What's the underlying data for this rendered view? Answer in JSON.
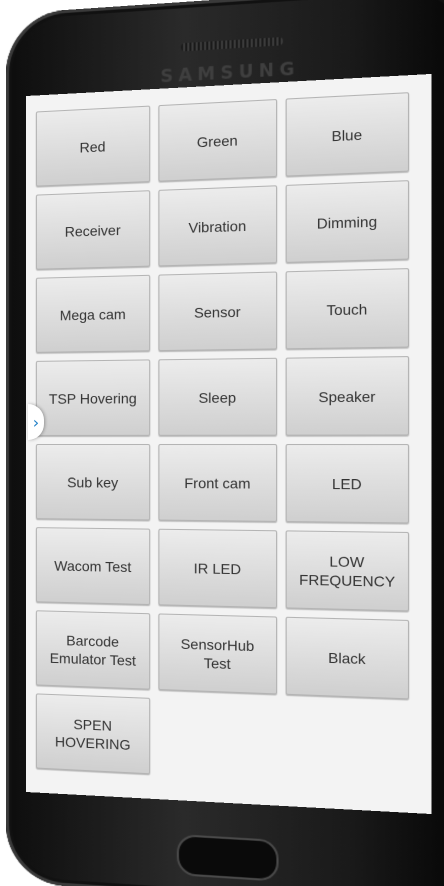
{
  "device": {
    "brand": "SAMSUNG"
  },
  "screen": {
    "buttons": [
      {
        "label": "Red"
      },
      {
        "label": "Green"
      },
      {
        "label": "Blue"
      },
      {
        "label": "Receiver"
      },
      {
        "label": "Vibration"
      },
      {
        "label": "Dimming"
      },
      {
        "label": "Mega cam"
      },
      {
        "label": "Sensor"
      },
      {
        "label": "Touch"
      },
      {
        "label": "TSP Hovering"
      },
      {
        "label": "Sleep"
      },
      {
        "label": "Speaker"
      },
      {
        "label": "Sub key"
      },
      {
        "label": "Front cam"
      },
      {
        "label": "LED"
      },
      {
        "label": "Wacom Test"
      },
      {
        "label": "IR LED"
      },
      {
        "label": "LOW\nFREQUENCY"
      },
      {
        "label": "Barcode\nEmulator Test"
      },
      {
        "label": "SensorHub\nTest"
      },
      {
        "label": "Black"
      },
      {
        "label": "SPEN\nHOVERING"
      }
    ],
    "side_handle_icon": "chevron-right-icon"
  },
  "colors": {
    "screen_background": "#f3f3f3",
    "button_face": "#dcdcdc",
    "button_text": "#333333",
    "handle_arrow": "#1f7fc7"
  }
}
